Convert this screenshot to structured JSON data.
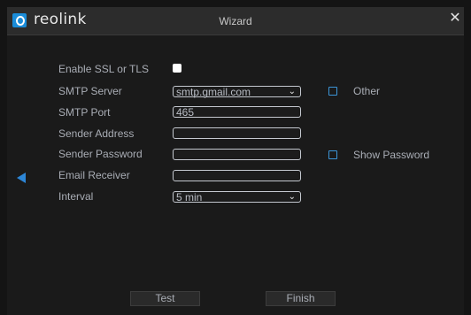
{
  "header": {
    "brand": "reolink",
    "title": "Wizard",
    "close_glyph": "✕"
  },
  "form": {
    "ssl_label": "Enable SSL or TLS",
    "ssl_checked": true,
    "smtp_server_label": "SMTP Server",
    "smtp_server_value": "smtp.gmail.com",
    "other_label": "Other",
    "other_checked": false,
    "smtp_port_label": "SMTP Port",
    "smtp_port_value": "465",
    "sender_address_label": "Sender Address",
    "sender_address_value": "",
    "sender_password_label": "Sender Password",
    "sender_password_value": "",
    "show_password_label": "Show Password",
    "show_password_checked": false,
    "email_receiver_label": "Email Receiver",
    "email_receiver_value": "",
    "interval_label": "Interval",
    "interval_value": "5 min"
  },
  "buttons": {
    "test": "Test",
    "finish": "Finish"
  },
  "colors": {
    "accent": "#2d86d6",
    "background": "#1a1a1a",
    "titlebar": "#2c2c2c"
  },
  "icons": {
    "logo": "reolink-logo-icon",
    "close": "close-icon",
    "back": "back-arrow-icon",
    "dropdown": "chevron-down-icon"
  }
}
